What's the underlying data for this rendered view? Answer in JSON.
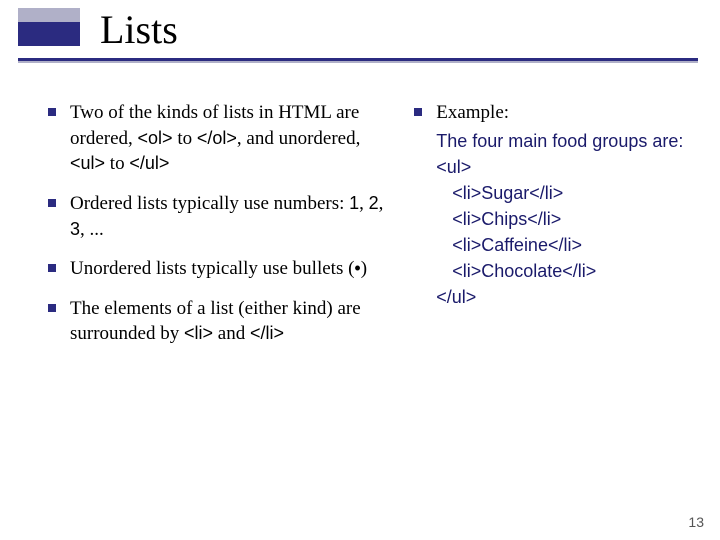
{
  "title": "Lists",
  "left": {
    "items": [
      {
        "pre1": "Two of the kinds of lists in HTML are ordered, ",
        "code1": "<ol>",
        "mid1": " to ",
        "code2": "</ol>",
        "mid2": ", and unordered, ",
        "code3": "<ul>",
        "mid3": " to ",
        "code4": "</ul>"
      },
      {
        "pre1": "Ordered lists typically use numbers: ",
        "code1": "1",
        "mid1": ", ",
        "code2": "2",
        "mid2": ", ",
        "code3": "3",
        "mid3": ", ..."
      },
      {
        "pre1": "Unordered lists typically use bullets (",
        "code1": "•",
        "mid1": ")"
      },
      {
        "pre1": "The elements of a list (either kind) are surrounded by ",
        "code1": "<li>",
        "mid1": " and ",
        "code2": "</li>"
      }
    ]
  },
  "right": {
    "label": "Example:",
    "example": {
      "line1": "The four main food groups are:",
      "open": "<ul>",
      "li1": "<li>Sugar</li>",
      "li2": "<li>Chips</li>",
      "li3": "<li>Caffeine</li>",
      "li4": "<li>Chocolate</li>",
      "close": "</ul>"
    }
  },
  "page_number": "13"
}
